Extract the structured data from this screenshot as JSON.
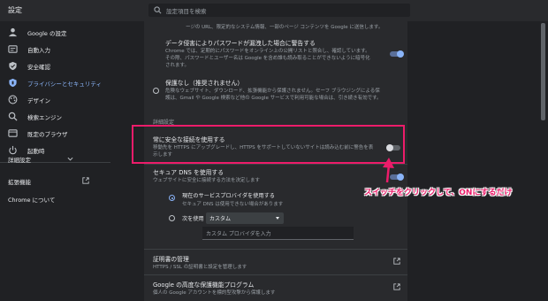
{
  "app": {
    "title": "設定"
  },
  "search": {
    "placeholder": "設定項目を検索"
  },
  "sidebar": {
    "items": [
      {
        "label": "Google の設定",
        "icon": "person-icon"
      },
      {
        "label": "自動入力",
        "icon": "autofill-icon"
      },
      {
        "label": "安全確認",
        "icon": "shield-check-icon"
      },
      {
        "label": "プライバシーとセキュリティ",
        "icon": "shield-icon",
        "active": true
      },
      {
        "label": "デザイン",
        "icon": "palette-icon"
      },
      {
        "label": "検索エンジン",
        "icon": "search-icon"
      },
      {
        "label": "既定のブラウザ",
        "icon": "browser-icon"
      },
      {
        "label": "起動時",
        "icon": "power-icon"
      }
    ],
    "advanced": "詳細設定",
    "extensions": "拡張機能",
    "about": "Chrome について"
  },
  "main": {
    "top_text": "ージの URL、限定的なシステム情報、一部のページ コンテンツを Google に送信します。",
    "breach": {
      "title": "データ侵害によりパスワードが漏洩した場合に警告する",
      "desc1": "Chrome では、定期的にパスワードをオンライン上の公開リストと照合し、確認しています。",
      "desc2": "その際、パスワードとユーザー名は Google を含め誰も読み取ることができないように暗号化",
      "desc3": "されます。",
      "toggle_on": true
    },
    "no_protection": {
      "title": "保護なし（推奨されません）",
      "desc1": "危険なウェブサイト、ダウンロード、拡張機能から保護されません。セーフ ブラウジングによる保",
      "desc2": "護は、Gmail や Google 検索など他の Google サービスで利用可能な場合は、引き続き有効です。"
    },
    "advanced_header": "詳細設定",
    "https": {
      "title": "常に安全な接続を使用する",
      "desc1": "移動先を HTTPS にアップグレードし、HTTPS をサポートしていないサイトは読み込む前に警告を表",
      "desc2": "示します",
      "toggle_on": false
    },
    "dns": {
      "title": "セキュア DNS を使用する",
      "desc": "ウェブサイトに安全に接続する方法を決定します",
      "toggle_on": true,
      "opt1_title": "現在のサービスプロバイダを使用する",
      "opt1_desc": "セキュア DNS は使用できない場合があります",
      "opt2_label": "次を使用",
      "opt2_select": "カスタム",
      "custom_placeholder": "カスタム プロバイダを入力"
    },
    "cert": {
      "title": "証明書の管理",
      "desc": "HTTPS / SSL の証明書と設定を管理します"
    },
    "advanced_protection": {
      "title": "Google の高度な保護機能プログラム",
      "desc": "個人の Google アカウントを標的型攻撃から保護します"
    }
  },
  "annotation": {
    "callout": "スイッチをクリックして、ONにするだけ",
    "color": "#ec1c6a"
  },
  "colors": {
    "accent": "#8ab4f8",
    "annotation": "#ec1c6a"
  }
}
